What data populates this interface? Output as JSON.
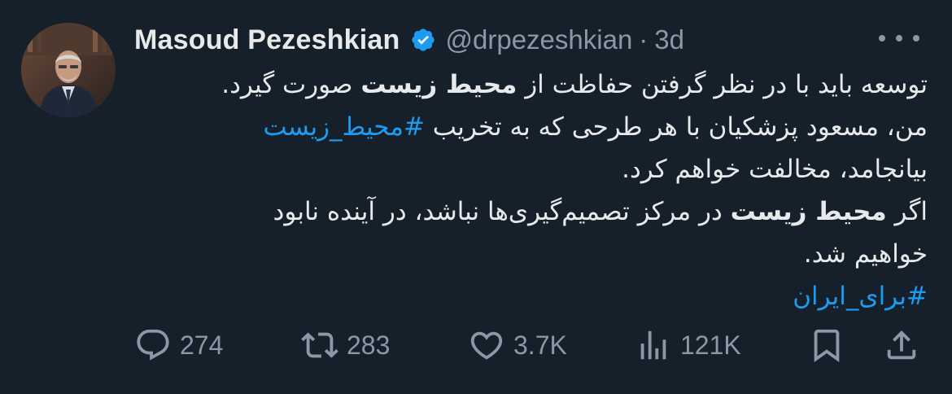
{
  "author": {
    "display_name": "Masoud Pezeshkian",
    "handle": "@drpezeshkian",
    "separator": "·",
    "age": "3d",
    "verified_color": "#1d9bf0"
  },
  "tweet": {
    "line1_pre": "توسعه باید با در نظر گرفتن حفاظت از ",
    "line1_bold": "محیط زیست",
    "line1_post": " صورت گیرد.",
    "line2_pre": "من، مسعود پزشکیان با هر طرحی که به تخریب ",
    "line2_hashtag": "#محیط_زیست",
    "line3": "بیانجامد، مخالفت خواهم کرد.",
    "line4_pre": "اگر ",
    "line4_bold": "محیط زیست",
    "line4_post": " در مرکز تصمیم‌گیری‌ها نباشد، در آینده نابود",
    "line5": "خواهیم شد.",
    "line6_hashtag": "#برای_ایران"
  },
  "actions": {
    "replies": "274",
    "retweets": "283",
    "likes": "3.7K",
    "views": "121K"
  },
  "icons": {
    "more": "more-icon",
    "reply": "reply-icon",
    "retweet": "retweet-icon",
    "like": "heart-icon",
    "views": "views-icon",
    "bookmark": "bookmark-icon",
    "share": "share-icon",
    "verified": "verified-badge-icon"
  },
  "colors": {
    "background": "#15202b",
    "text": "#e7e9ea",
    "muted": "#8b98a5",
    "accent": "#1d9bf0"
  }
}
